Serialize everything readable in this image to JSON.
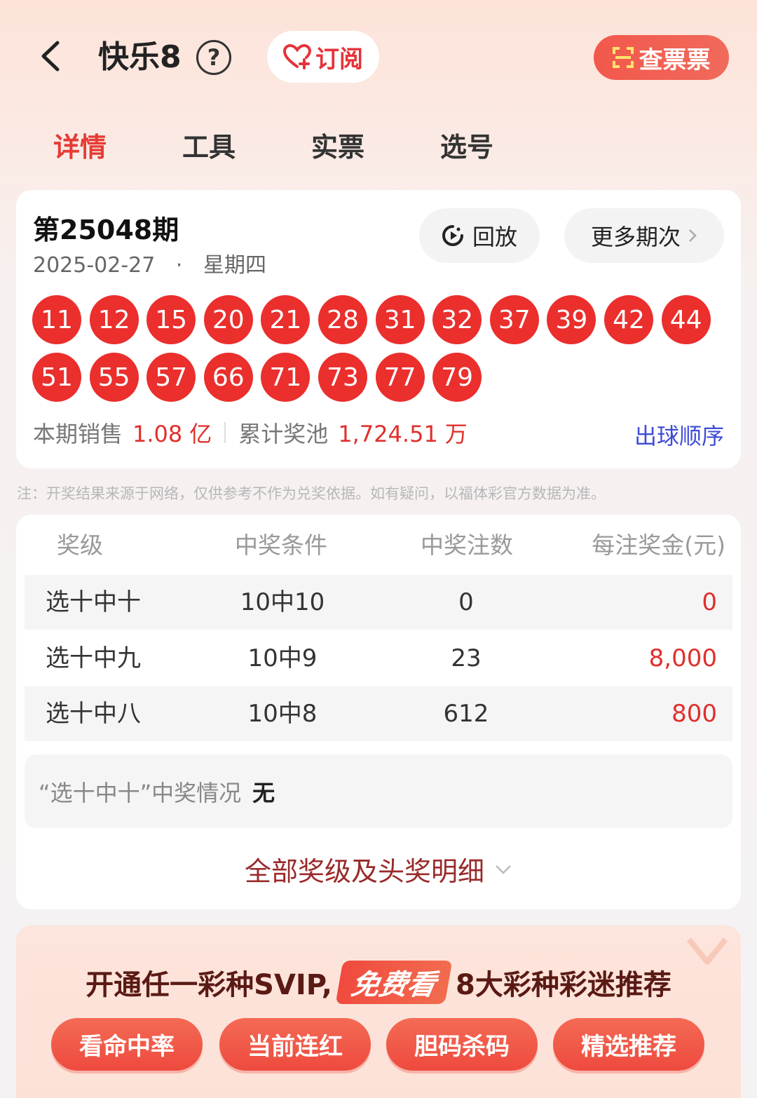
{
  "header": {
    "title": "快乐8",
    "help": "?",
    "subscribe_label": "订阅",
    "check_ticket_label": "查票票"
  },
  "tabs": [
    {
      "label": "详情",
      "active": true
    },
    {
      "label": "工具",
      "active": false
    },
    {
      "label": "实票",
      "active": false
    },
    {
      "label": "选号",
      "active": false
    }
  ],
  "draw": {
    "issue": "第25048期",
    "date": "2025-02-27",
    "dot": "·",
    "weekday": "星期四",
    "replay_label": "回放",
    "more_label": "更多期次",
    "numbers": [
      "11",
      "12",
      "15",
      "20",
      "21",
      "28",
      "31",
      "32",
      "37",
      "39",
      "42",
      "44",
      "51",
      "55",
      "57",
      "66",
      "71",
      "73",
      "77",
      "79"
    ],
    "sales_label": "本期销售",
    "sales_value": "1.08",
    "sales_unit": "亿",
    "pool_label": "累计奖池",
    "pool_value": "1,724.51",
    "pool_unit": "万",
    "order_link": "出球顺序"
  },
  "note": "注：开奖结果来源于网络，仅供参考不作为兑奖依据。如有疑问，以福体彩官方数据为准。",
  "prize_table": {
    "headers": [
      "奖级",
      "中奖条件",
      "中奖注数",
      "每注奖金(元)"
    ],
    "rows": [
      {
        "level": "选十中十",
        "condition": "10中10",
        "count": "0",
        "amount": "0"
      },
      {
        "level": "选十中九",
        "condition": "10中9",
        "count": "23",
        "amount": "8,000"
      },
      {
        "level": "选十中八",
        "condition": "10中8",
        "count": "612",
        "amount": "800"
      }
    ],
    "summary_label": "“选十中十”中奖情况",
    "summary_value": "无",
    "detail_link": "全部奖级及头奖明细"
  },
  "promo": {
    "title_pre": "开通任一彩种SVIP,",
    "title_free": "免费看",
    "title_post": "8大彩种彩迷推荐",
    "buttons": [
      "看命中率",
      "当前连红",
      "胆码杀码",
      "精选推荐"
    ]
  },
  "colors": {
    "accent": "#e63b35",
    "ball": "#ea2f2d",
    "link_blue": "#3f4cd6"
  }
}
